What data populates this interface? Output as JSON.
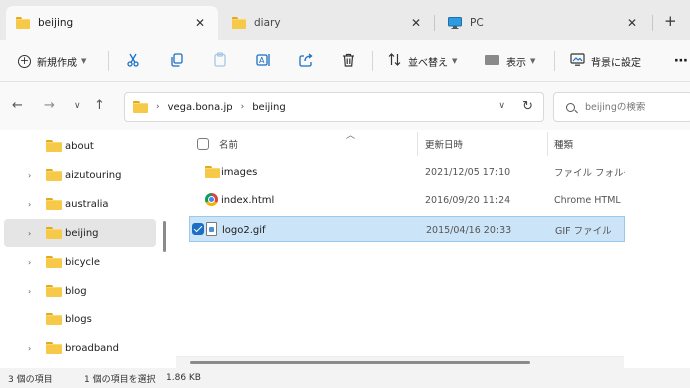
{
  "tabs": [
    {
      "label": "beijing",
      "close": "✕",
      "active": true
    },
    {
      "label": "diary",
      "close": "✕",
      "active": false
    },
    {
      "label": "PC",
      "close": "✕",
      "active": false
    }
  ],
  "new_tab": "+",
  "toolbar": {
    "new_label": "新規作成",
    "sort_label": "並べ替え",
    "view_label": "表示",
    "background_label": "背景に設定",
    "more": "⋯"
  },
  "address": {
    "crumbs": [
      "vega.bona.jp",
      "beijing"
    ]
  },
  "search": {
    "placeholder": "beijingの検索"
  },
  "sidebar": {
    "items": [
      {
        "label": "about",
        "expandable": false,
        "selected": false
      },
      {
        "label": "aizutouring",
        "expandable": true,
        "selected": false
      },
      {
        "label": "australia",
        "expandable": true,
        "selected": false
      },
      {
        "label": "beijing",
        "expandable": true,
        "selected": true
      },
      {
        "label": "bicycle",
        "expandable": true,
        "selected": false
      },
      {
        "label": "blog",
        "expandable": true,
        "selected": false
      },
      {
        "label": "blogs",
        "expandable": false,
        "selected": false
      },
      {
        "label": "broadband",
        "expandable": true,
        "selected": false
      }
    ]
  },
  "columns": {
    "name": "名前",
    "date": "更新日時",
    "type": "種類"
  },
  "files": [
    {
      "name": "images",
      "date": "2021/12/05 17:10",
      "type": "ファイル フォルダー",
      "icon": "folder-icon",
      "selected": false
    },
    {
      "name": "index.html",
      "date": "2016/09/20 11:24",
      "type": "Chrome HTML",
      "icon": "chrome-icon",
      "selected": false
    },
    {
      "name": "logo2.gif",
      "date": "2015/04/16 20:33",
      "type": "GIF ファイル",
      "icon": "gif-file-icon",
      "selected": true
    }
  ],
  "status": {
    "item_count": "3 個の項目",
    "selection": "1 個の項目を選択",
    "size": "1.86 KB"
  },
  "colors": {
    "accent": "#1a6fc4",
    "selection_bg": "#cce4f7",
    "folder": "#f7c948"
  }
}
